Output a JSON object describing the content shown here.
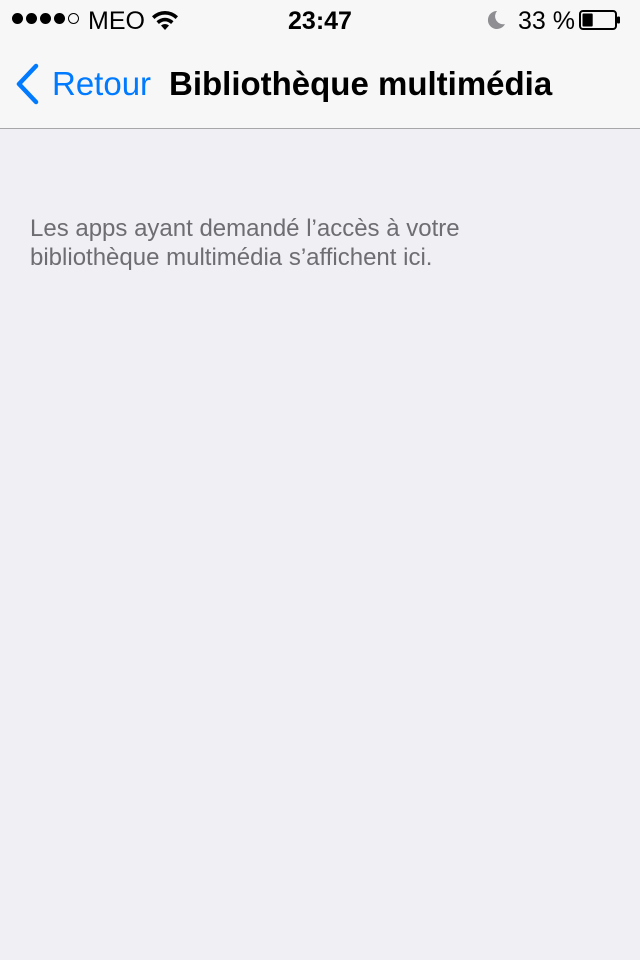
{
  "status_bar": {
    "carrier": "MEO",
    "time": "23:47",
    "battery_percent": "33 %",
    "battery_level": 0.33,
    "signal_bars_filled": 4,
    "signal_bars_total": 5,
    "icons": [
      "signal-dots",
      "wifi-icon",
      "moon-icon",
      "battery-icon"
    ]
  },
  "nav": {
    "back_label": "Retour",
    "title": "Bibliothèque multimédia",
    "accent_color": "#007aff"
  },
  "main": {
    "message_line1": "Les apps ayant demandé l’accès à votre",
    "message_line2": "bibliothèque multimédia s’affichent ici."
  }
}
